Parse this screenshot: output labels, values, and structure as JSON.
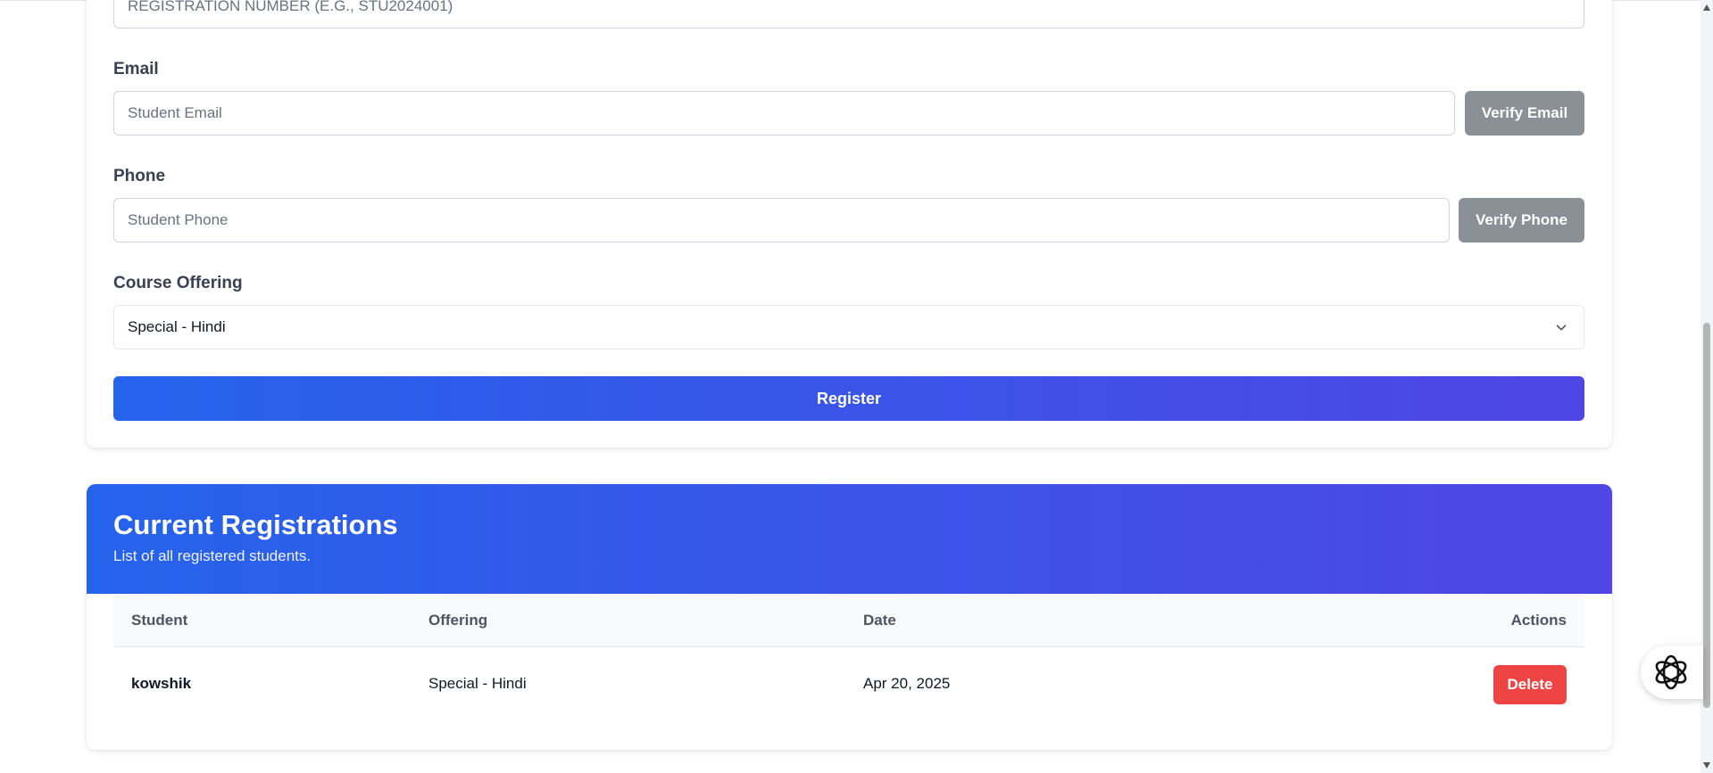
{
  "form": {
    "registration_placeholder": "REGISTRATION NUMBER (E.G., STU2024001)",
    "email_label": "Email",
    "email_placeholder": "Student Email",
    "verify_email_label": "Verify Email",
    "phone_label": "Phone",
    "phone_placeholder": "Student Phone",
    "verify_phone_label": "Verify Phone",
    "course_label": "Course Offering",
    "course_selected": "Special - Hindi",
    "register_label": "Register"
  },
  "registrations": {
    "title": "Current Registrations",
    "subtitle": "List of all registered students.",
    "columns": [
      "Student",
      "Offering",
      "Date",
      "Actions"
    ],
    "rows": [
      {
        "student": "kowshik",
        "offering": "Special - Hindi",
        "date": "Apr 20, 2025",
        "action_label": "Delete"
      }
    ]
  },
  "colors": {
    "primary_gradient_start": "#2563eb",
    "primary_gradient_end": "#4f46e5",
    "danger": "#ef4444",
    "muted_button": "#8b8f96"
  },
  "icons": {
    "select": "chevron-down-icon",
    "assistant": "openai-knot-icon"
  }
}
